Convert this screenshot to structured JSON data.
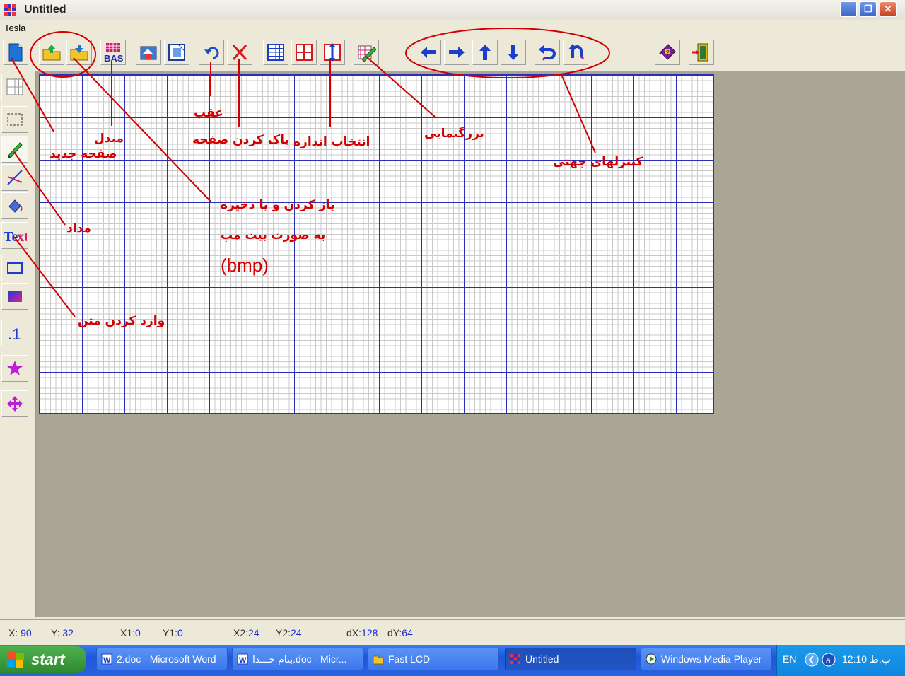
{
  "window": {
    "title": "Untitled",
    "min": "_",
    "max": "❐",
    "close": "✕"
  },
  "menu": {
    "items": [
      {
        "label": "Tesla"
      }
    ]
  },
  "canvas": {
    "bg": "#ffffff",
    "major_grid": "#2b2fb8",
    "minor_grid": "#c9c9c9"
  },
  "status": {
    "x_label": "X:",
    "x_val": "90",
    "y_label": "Y:",
    "y_val": "32",
    "x1_label": "X1:",
    "x1_val": "0",
    "y1_label": "Y1:",
    "y1_val": "0",
    "x2_label": "X2:",
    "x2_val": "24",
    "y2_label": "Y2:",
    "y2_val": "24",
    "dx_label": "dX:",
    "dx_val": "128",
    "dy_label": "dY:",
    "dy_val": "64"
  },
  "taskbar": {
    "start_label": "start",
    "tasks": [
      {
        "label": "2.doc - Microsoft Word"
      },
      {
        "label": "بنام خـــدا.doc - Micr..."
      },
      {
        "label": "Fast LCD"
      },
      {
        "label": "Untitled"
      },
      {
        "label": "Windows Media Player"
      }
    ],
    "lang": "EN",
    "clock": "12:10 ب.ظ"
  },
  "annotations": {
    "new_page": "صفحه جدید",
    "converter": "مبدل",
    "undo": "عقب",
    "clear_page": "پاک کردن صفحه",
    "size_select": "انتخاب اندازه",
    "zoom": "بزرگنمایی",
    "direction_controls": "کنترلهای جهتی",
    "open_save": "باز کردن و یا ذخیره",
    "as_bitmap": "به صورت بیت مپ",
    "bmp": "(bmp)",
    "pencil": "مداد",
    "text_input": "وارد کردن متن"
  },
  "accent_color": "#d20000"
}
